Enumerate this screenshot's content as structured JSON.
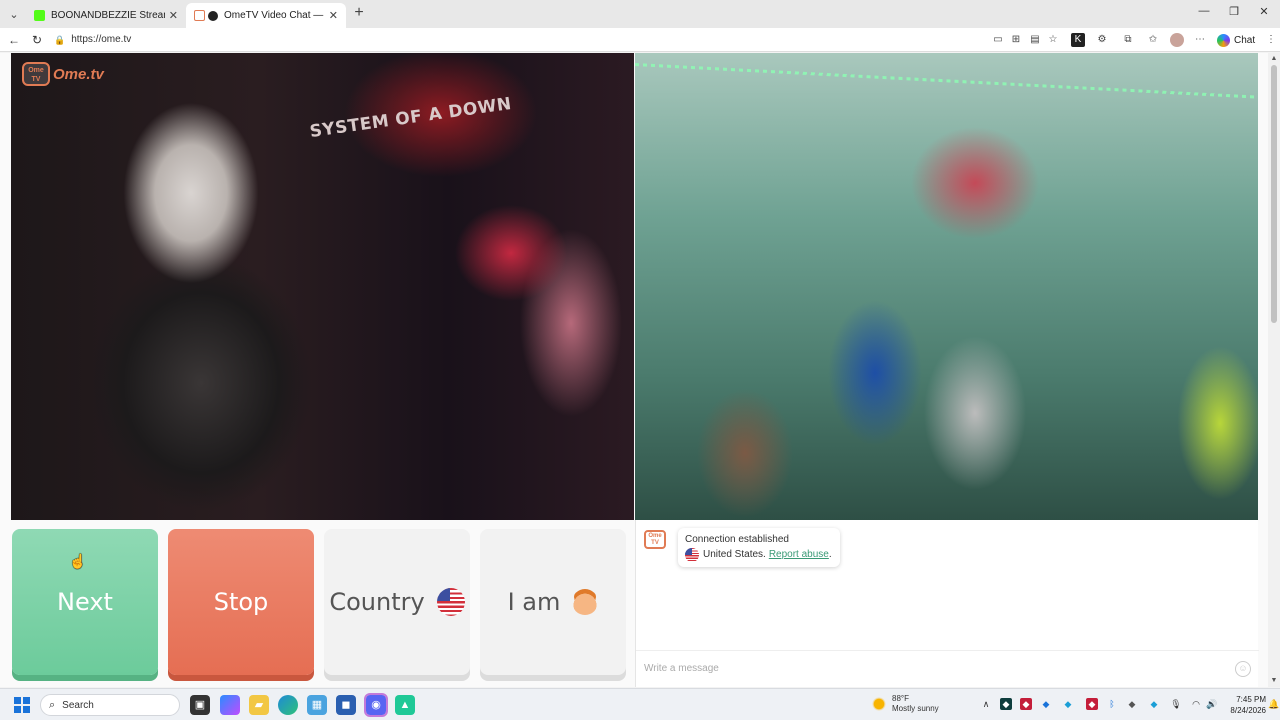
{
  "browser": {
    "tabs": [
      {
        "title": "BOONANDBEZZIE Stream - Watch",
        "favicon_color": "#53fc18",
        "active": false
      },
      {
        "title": "OmeTV Video Chat — Omeg",
        "favicon_color": "#e07b54",
        "active": true
      }
    ],
    "url": "https://ome.tv",
    "chat_label": "Chat"
  },
  "brand": {
    "badge": "Ome TV",
    "name": "Ome.tv"
  },
  "remote_video": {
    "banner_text": "SYSTEM OF A DOWN"
  },
  "controls": {
    "next_label": "Next",
    "stop_label": "Stop",
    "country_label": "Country",
    "iam_label": "I am",
    "colors": {
      "next": "#6ccb9b",
      "stop": "#e56e53"
    }
  },
  "chat": {
    "status": "Connection established",
    "country": "United States.",
    "report_link": "Report abuse",
    "report_suffix": ".",
    "input_placeholder": "Write a message"
  },
  "taskbar": {
    "search_label": "Search",
    "weather_temp": "88°F",
    "weather_desc": "Mostly sunny",
    "time": "7:45 PM",
    "date": "8/24/2026"
  }
}
